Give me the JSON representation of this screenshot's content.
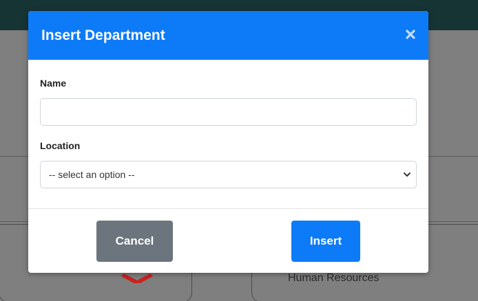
{
  "background": {
    "card_label": "Human Resources"
  },
  "modal": {
    "title": "Insert Department",
    "name_label": "Name",
    "name_value": "",
    "name_placeholder": "",
    "location_label": "Location",
    "location_selected": "-- select an option --",
    "cancel_label": "Cancel",
    "insert_label": "Insert"
  },
  "colors": {
    "header_blue": "#0d7bf7",
    "cancel_gray": "#6c757d",
    "bg_header": "#173435"
  },
  "icons": {
    "close": "close-icon",
    "chevron": "chevron-down-icon",
    "delete": "delete-x-icon"
  }
}
